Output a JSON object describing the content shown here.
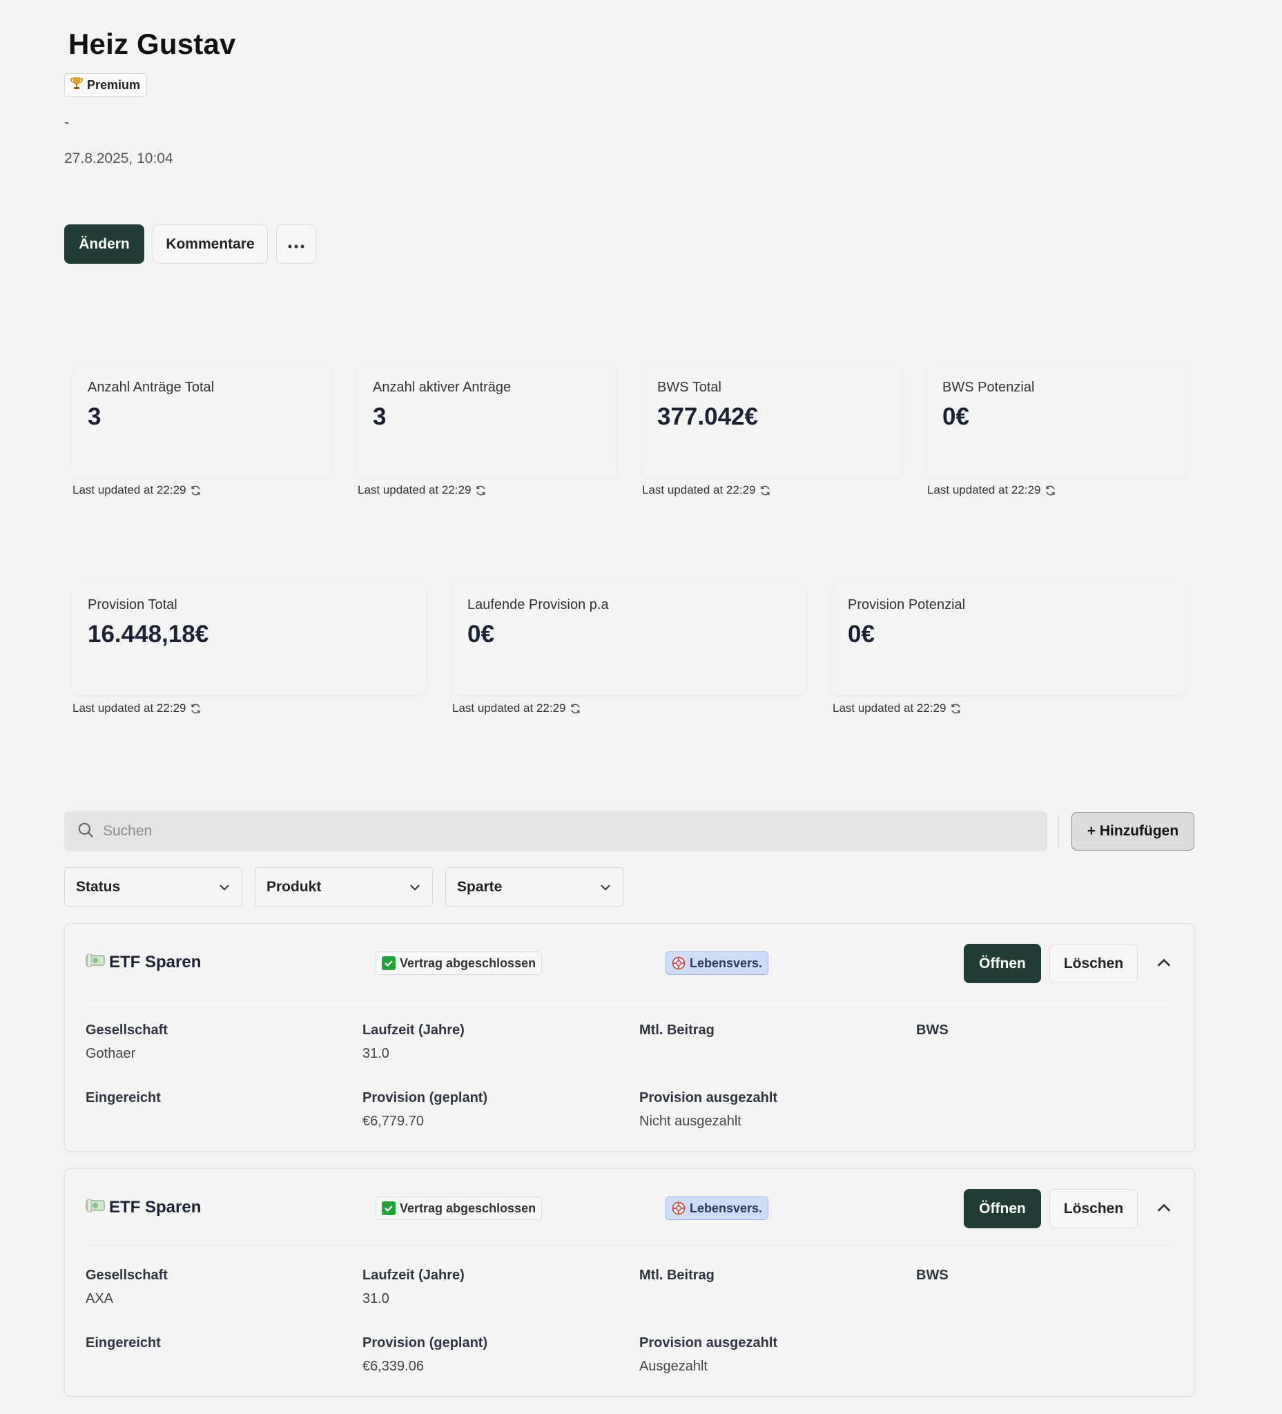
{
  "header": {
    "name": "Heiz Gustav",
    "badge": "Premium",
    "dash": "-",
    "datetime": "27.8.2025, 10:04"
  },
  "actions": {
    "edit": "Ändern",
    "comments": "Kommentare",
    "more": "···"
  },
  "stats_row1": [
    {
      "label": "Anzahl Anträge Total",
      "value": "3",
      "updated": "Last updated at 22:29"
    },
    {
      "label": "Anzahl aktiver Anträge",
      "value": "3",
      "updated": "Last updated at 22:29"
    },
    {
      "label": "BWS Total",
      "value": "377.042€",
      "updated": "Last updated at 22:29"
    },
    {
      "label": "BWS Potenzial",
      "value": "0€",
      "updated": "Last updated at 22:29"
    }
  ],
  "stats_row2": [
    {
      "label": "Provision Total",
      "value": "16.448,18€",
      "updated": "Last updated at 22:29"
    },
    {
      "label": "Laufende Provision p.a",
      "value": "0€",
      "updated": "Last updated at 22:29"
    },
    {
      "label": "Provision Potenzial",
      "value": "0€",
      "updated": "Last updated at 22:29"
    }
  ],
  "search": {
    "placeholder": "Suchen",
    "add_label": "+ Hinzufügen"
  },
  "filters": [
    "Status",
    "Produkt",
    "Sparte"
  ],
  "contracts": [
    {
      "name": "ETF Sparen",
      "status": "Vertrag abgeschlossen",
      "sparte": "Lebensvers.",
      "open": "Öffnen",
      "delete": "Löschen",
      "fields": {
        "gesellschaft_label": "Gesellschaft",
        "gesellschaft": "Gothaer",
        "laufzeit_label": "Laufzeit (Jahre)",
        "laufzeit": "31.0",
        "beitrag_label": "Mtl. Beitrag",
        "beitrag": "",
        "bws_label": "BWS",
        "bws": "",
        "eingereicht_label": "Eingereicht",
        "eingereicht": "",
        "prov_geplant_label": "Provision (geplant)",
        "prov_geplant": "€6,779.70",
        "prov_ausgezahlt_label": "Provision ausgezahlt",
        "prov_ausgezahlt": "Nicht ausgezahlt"
      }
    },
    {
      "name": "ETF Sparen",
      "status": "Vertrag abgeschlossen",
      "sparte": "Lebensvers.",
      "open": "Öffnen",
      "delete": "Löschen",
      "fields": {
        "gesellschaft_label": "Gesellschaft",
        "gesellschaft": "AXA",
        "laufzeit_label": "Laufzeit (Jahre)",
        "laufzeit": "31.0",
        "beitrag_label": "Mtl. Beitrag",
        "beitrag": "",
        "bws_label": "BWS",
        "bws": "",
        "eingereicht_label": "Eingereicht",
        "eingereicht": "",
        "prov_geplant_label": "Provision (geplant)",
        "prov_geplant": "€6,339.06",
        "prov_ausgezahlt_label": "Provision ausgezahlt",
        "prov_ausgezahlt": "Ausgezahlt"
      }
    }
  ],
  "colors": {
    "primary": "#203c34",
    "background": "#f3f3f3",
    "sparte_tag": "#cfdcf5",
    "status_check": "#22a33a"
  },
  "icons": {
    "badge": "trophy-icon",
    "refresh": "refresh-icon",
    "search": "search-icon",
    "dropdown": "chevron-down-icon",
    "collapse": "chevron-up-icon",
    "product": "money-icon",
    "status": "checkmark-icon",
    "sparte": "lifebuoy-icon"
  }
}
